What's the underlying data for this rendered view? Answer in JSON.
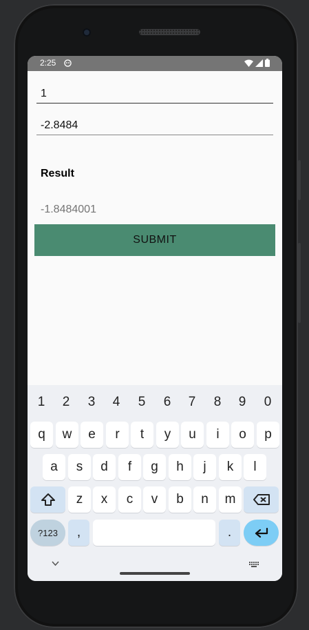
{
  "status_bar": {
    "time": "2:25"
  },
  "form": {
    "field1_value": "1",
    "field2_value": "-2.8484",
    "result_label": "Result",
    "result_value": "-1.8484001",
    "submit_label": "SUBMIT"
  },
  "keyboard": {
    "number_row": [
      "1",
      "2",
      "3",
      "4",
      "5",
      "6",
      "7",
      "8",
      "9",
      "0"
    ],
    "row1": [
      "q",
      "w",
      "e",
      "r",
      "t",
      "y",
      "u",
      "i",
      "o",
      "p"
    ],
    "row2": [
      "a",
      "s",
      "d",
      "f",
      "g",
      "h",
      "j",
      "k",
      "l"
    ],
    "row3": [
      "z",
      "x",
      "c",
      "v",
      "b",
      "n",
      "m"
    ],
    "symbols_label": "?123",
    "comma_label": ",",
    "period_label": "."
  },
  "colors": {
    "submit_bg": "#4a8b71",
    "status_bar_bg": "#757575",
    "enter_key": "#7dcdf5"
  }
}
